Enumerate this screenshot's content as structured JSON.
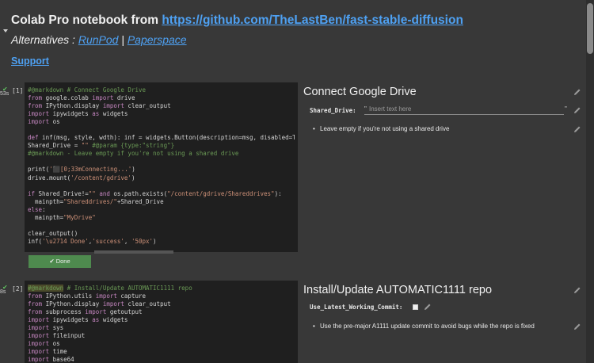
{
  "header": {
    "title_prefix": "Colab Pro notebook from ",
    "title_link": "https://github.com/TheLastBen/fast-stable-diffusion",
    "alternatives_prefix": "Alternatives : ",
    "alt_link_1": "RunPod",
    "alt_separator": " | ",
    "alt_link_2": "Paperspace",
    "support_link": "Support"
  },
  "cell1": {
    "exec_time": "53s",
    "exec_count": "[1]",
    "code": [
      [
        {
          "t": "#@markdown # Connect Google Drive",
          "c": "cmt"
        }
      ],
      [
        {
          "t": "from",
          "c": "kw"
        },
        {
          "t": " google.colab "
        },
        {
          "t": "import",
          "c": "kw"
        },
        {
          "t": " drive"
        }
      ],
      [
        {
          "t": "from",
          "c": "kw"
        },
        {
          "t": " IPython.display "
        },
        {
          "t": "import",
          "c": "kw"
        },
        {
          "t": " clear_output"
        }
      ],
      [
        {
          "t": "import",
          "c": "kw"
        },
        {
          "t": " ipywidgets "
        },
        {
          "t": "as",
          "c": "kw"
        },
        {
          "t": " widgets"
        }
      ],
      [
        {
          "t": "import",
          "c": "kw"
        },
        {
          "t": " os"
        }
      ],
      [
        {
          "t": ""
        }
      ],
      [
        {
          "t": "def",
          "c": "kw"
        },
        {
          "t": " inf(msg, style, wdth): inf = widgets.Button(description=msg, disabled=T"
        }
      ],
      [
        {
          "t": "Shared_Drive = "
        },
        {
          "t": "\"\"",
          "c": "str"
        },
        {
          "t": " #@param {type:\"string\"}",
          "c": "cmt"
        }
      ],
      [
        {
          "t": "#@markdown - Leave empty if you're not using a shared drive",
          "c": "cmt"
        }
      ],
      [
        {
          "t": ""
        }
      ],
      [
        {
          "t": "print("
        },
        {
          "t": "'⬛[0;33mConnecting...'",
          "c": "str"
        },
        {
          "t": ")"
        }
      ],
      [
        {
          "t": "drive.mount("
        },
        {
          "t": "'/content/gdrive'",
          "c": "str"
        },
        {
          "t": ")"
        }
      ],
      [
        {
          "t": ""
        }
      ],
      [
        {
          "t": "if",
          "c": "kw"
        },
        {
          "t": " Shared_Drive!="
        },
        {
          "t": "\"\"",
          "c": "str"
        },
        {
          "t": " "
        },
        {
          "t": "and",
          "c": "kw"
        },
        {
          "t": " os.path.exists("
        },
        {
          "t": "\"/content/gdrive/Shareddrives\"",
          "c": "str"
        },
        {
          "t": "):"
        }
      ],
      [
        {
          "t": "  mainpth="
        },
        {
          "t": "\"Shareddrives/\"",
          "c": "str"
        },
        {
          "t": "+Shared_Drive"
        }
      ],
      [
        {
          "t": "else",
          "c": "kw"
        },
        {
          "t": ":"
        }
      ],
      [
        {
          "t": "  mainpth="
        },
        {
          "t": "\"MyDrive\"",
          "c": "str"
        }
      ],
      [
        {
          "t": ""
        }
      ],
      [
        {
          "t": "clear_output()"
        }
      ],
      [
        {
          "t": "inf("
        },
        {
          "t": "'\\u2714 Done'",
          "c": "str"
        },
        {
          "t": ","
        },
        {
          "t": "'success'",
          "c": "str"
        },
        {
          "t": ", "
        },
        {
          "t": "'50px'",
          "c": "str"
        },
        {
          "t": ")"
        }
      ]
    ],
    "output_button": "✔ Done",
    "form": {
      "title": "Connect Google Drive",
      "param_label": "Shared_Drive:",
      "param_placeholder": "Insert text here",
      "note": "Leave empty if you're not using a shared drive"
    }
  },
  "cell2": {
    "exec_time": "8s",
    "exec_count": "[2]",
    "code": [
      [
        {
          "t": "#@markdown",
          "c": "cmt hl"
        },
        {
          "t": " # Install/Update AUTOMATIC1111 repo",
          "c": "cmt"
        }
      ],
      [
        {
          "t": "from",
          "c": "kw"
        },
        {
          "t": " IPython.utils "
        },
        {
          "t": "import",
          "c": "kw"
        },
        {
          "t": " capture"
        }
      ],
      [
        {
          "t": "from",
          "c": "kw"
        },
        {
          "t": " IPython.display "
        },
        {
          "t": "import",
          "c": "kw"
        },
        {
          "t": " clear_output"
        }
      ],
      [
        {
          "t": "from",
          "c": "kw"
        },
        {
          "t": " subprocess "
        },
        {
          "t": "import",
          "c": "kw"
        },
        {
          "t": " getoutput"
        }
      ],
      [
        {
          "t": "import",
          "c": "kw"
        },
        {
          "t": " ipywidgets "
        },
        {
          "t": "as",
          "c": "kw"
        },
        {
          "t": " widgets"
        }
      ],
      [
        {
          "t": "import",
          "c": "kw"
        },
        {
          "t": " sys"
        }
      ],
      [
        {
          "t": "import",
          "c": "kw"
        },
        {
          "t": " fileinput"
        }
      ],
      [
        {
          "t": "import",
          "c": "kw"
        },
        {
          "t": " os"
        }
      ],
      [
        {
          "t": "import",
          "c": "kw"
        },
        {
          "t": " time"
        }
      ],
      [
        {
          "t": "import",
          "c": "kw"
        },
        {
          "t": " base64"
        }
      ]
    ],
    "form": {
      "title": "Install/Update AUTOMATIC1111 repo",
      "param_label": "Use_Latest_Working_Commit:",
      "note": "Use the pre-major A1111 update commit to avoid bugs while the repo is fixed"
    }
  },
  "colors": {
    "background": "#383838",
    "editor": "#1f1f1f",
    "link": "#4ea1f3",
    "comment": "#6a9955",
    "keyword": "#c586c0",
    "string": "#ce9178",
    "done_button": "#4e8a4e"
  }
}
